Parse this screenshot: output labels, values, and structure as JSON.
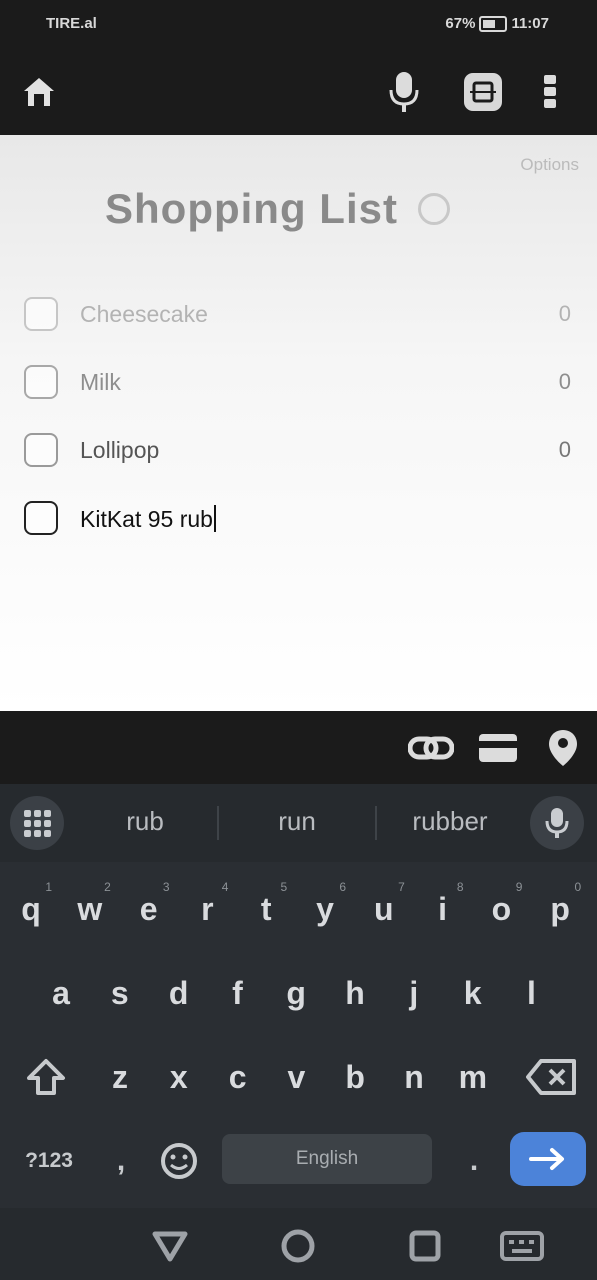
{
  "status_bar": {
    "left_text": "TIRE.al",
    "signal": "al",
    "right_text": "11:07",
    "battery_text": "67%"
  },
  "app_bar": {
    "icons": [
      "home-icon",
      "microphone-icon",
      "scan-icon",
      "more-vert-icon"
    ]
  },
  "list": {
    "options_label": "Options",
    "title": "Shopping List",
    "items": [
      {
        "label": "Cheesecake",
        "qty": "0"
      },
      {
        "label": "Milk",
        "qty": "0"
      },
      {
        "label": "Lollipop",
        "qty": "0"
      }
    ],
    "editing_item": {
      "value": "KitKat 95 rub"
    }
  },
  "action_bar": {
    "icons": [
      "link-icon",
      "card-icon",
      "location-pin-icon"
    ]
  },
  "keyboard": {
    "suggestions": [
      "rub",
      "run",
      "rubber"
    ],
    "row1": [
      "q",
      "w",
      "e",
      "r",
      "t",
      "y",
      "u",
      "i",
      "o",
      "p"
    ],
    "row1_hints": [
      "1",
      "2",
      "3",
      "4",
      "5",
      "6",
      "7",
      "8",
      "9",
      "0"
    ],
    "row2": [
      "a",
      "s",
      "d",
      "f",
      "g",
      "h",
      "j",
      "k",
      "l"
    ],
    "row3": [
      "z",
      "x",
      "c",
      "v",
      "b",
      "n",
      "m"
    ],
    "symbols_label": "?123",
    "comma_label": ",",
    "period_label": ".",
    "space_label": "English"
  },
  "colors": {
    "accent": "#4c83d9",
    "keyboard_bg": "#2a2e33",
    "bar_bg": "#1b1b1b"
  }
}
